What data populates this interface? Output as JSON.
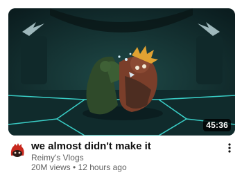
{
  "video": {
    "title": "we almost didn't make it",
    "channel": "Reimy's Vlogs",
    "views": "20M views",
    "separator": "•",
    "age": "12 hours ago",
    "duration": "45:36"
  },
  "icons": {
    "menu": "vertical-ellipsis-icon",
    "avatar": "channel-avatar"
  },
  "colors": {
    "title": "#0f0f0f",
    "secondary": "#606060",
    "thumbnail_bg": "#0f2a2b",
    "arena_glow": "#3fe0d8",
    "avatar_red": "#c8281e"
  }
}
